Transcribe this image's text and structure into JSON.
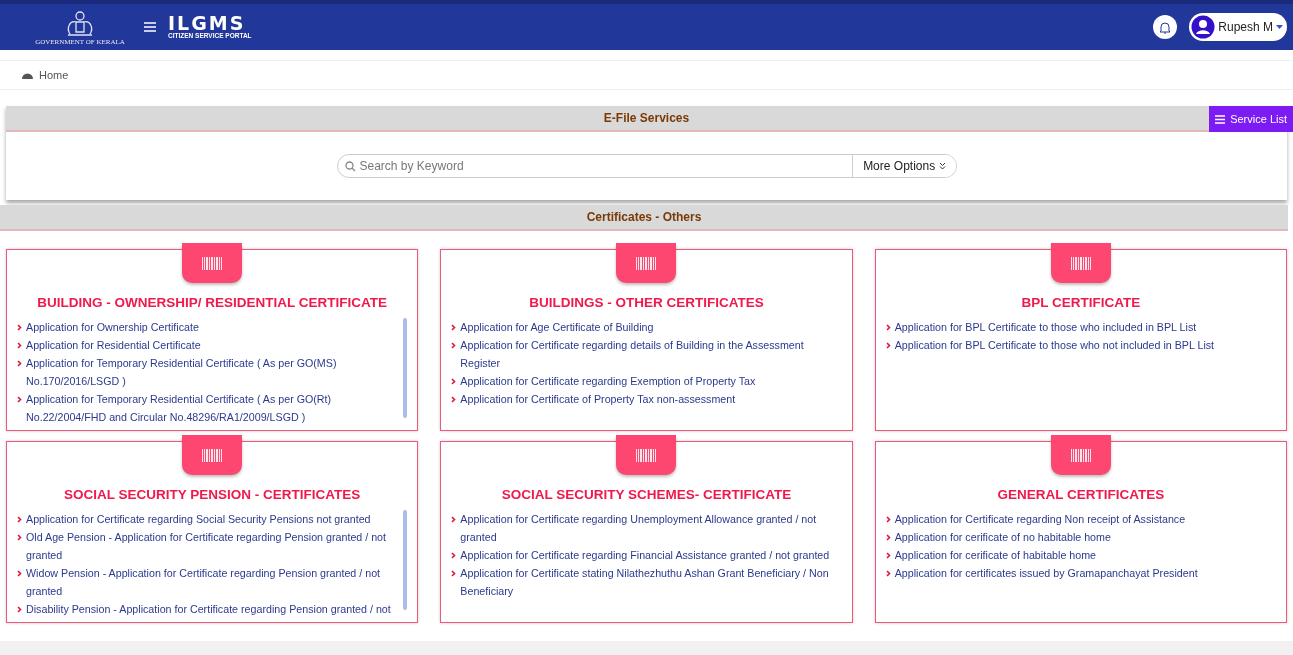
{
  "header": {
    "emblem_caption": "GOVERNMENT OF KERALA",
    "logo": "ILGMS",
    "logo_tagline": "CITIZEN SERVICE PORTAL",
    "user": "Rupesh M"
  },
  "breadcrumb": "Home",
  "efile": {
    "title": "E-File Services",
    "service_list": "Service List",
    "search": {
      "placeholder": "Search by Keyword"
    },
    "more_options": "More Options"
  },
  "section_title": "Certificates - Others",
  "cards": [
    {
      "title": "BUILDING - OWNERSHIP/ RESIDENTIAL CERTIFICATE",
      "scrollbar": true,
      "items": [
        "Application for Ownership Certificate",
        "Application for Residential Certificate",
        "Application for Temporary Residential Certificate ( As per GO(MS) No.170/2016/LSGD )",
        "Application for Temporary Residential Certificate ( As per GO(Rt) No.22/2004/FHD and Circular No.48296/RA1/2009/LSGD )"
      ]
    },
    {
      "title": "BUILDINGS - OTHER CERTIFICATES",
      "scrollbar": false,
      "items": [
        "Application for Age Certificate of Building",
        "Application for Certificate regarding details of Building in the Assessment Register",
        "Application for Certificate regarding Exemption of Property Tax",
        "Application for Certificate of Property Tax non-assessment"
      ]
    },
    {
      "title": "BPL CERTIFICATE",
      "scrollbar": false,
      "items": [
        "Application for BPL Certificate to those who included in BPL List",
        "Application for BPL Certificate to those who not included in BPL List"
      ]
    },
    {
      "title": "SOCIAL SECURITY PENSION - CERTIFICATES",
      "scrollbar": true,
      "items": [
        "Application for Certificate regarding Social Security Pensions not granted",
        "Old Age Pension - Application for Certificate regarding Pension granted / not granted",
        "Widow Pension - Application for Certificate regarding Pension granted / not granted",
        "Disability Pension - Application for Certificate regarding Pension granted / not"
      ]
    },
    {
      "title": "SOCIAL SECURITY SCHEMES- CERTIFICATE",
      "scrollbar": false,
      "items": [
        "Application for Certificate regarding Unemployment Allowance granted / not granted",
        "Application for Certificate regarding Financial Assistance granted / not granted",
        "Application for Certificate stating Nilathezhuthu Ashan Grant Beneficiary / Non Beneficiary"
      ]
    },
    {
      "title": "GENERAL CERTIFICATES",
      "scrollbar": false,
      "items": [
        "Application for Certificate regarding Non receipt of Assistance",
        "Application for cerificate of no habitable home",
        "Application for cerificate of habitable home",
        "Application for certificates issued by Gramapanchayat President"
      ]
    }
  ]
}
